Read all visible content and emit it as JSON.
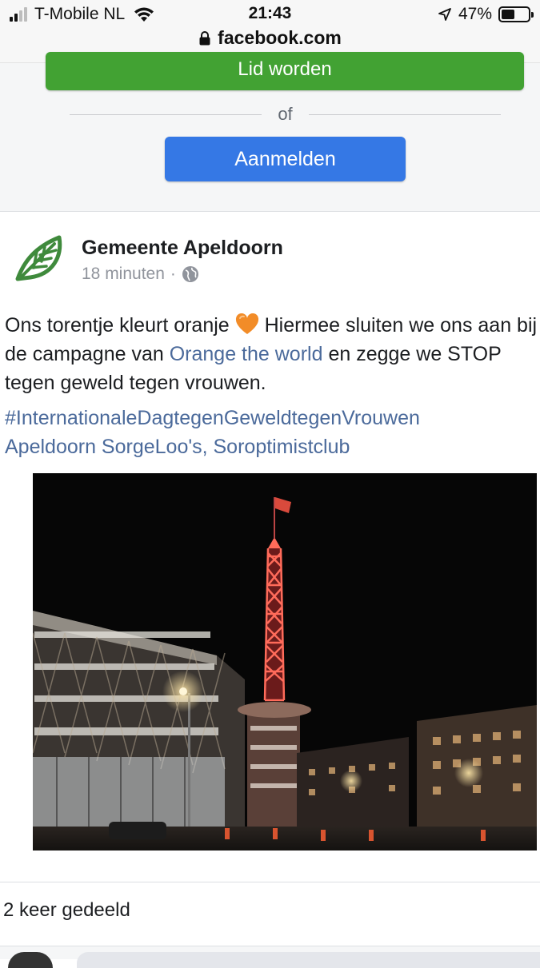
{
  "status_bar": {
    "carrier": "T-Mobile NL",
    "time": "21:43",
    "battery": "47%",
    "battery_level": 0.47,
    "signal_bars": 2
  },
  "address_bar": {
    "url": "facebook.com"
  },
  "login": {
    "join_label": "Lid worden",
    "or_label": "of",
    "login_label": "Aanmelden"
  },
  "post": {
    "page_name": "Gemeente Apeldoorn",
    "time_ago": "18 minuten",
    "separator": "·",
    "text_part1": "Ons torentje kleurt oranje",
    "text_part2": "Hiermee sluiten we ons aan bij de campagne van",
    "link_text": "Orange the world",
    "text_part3": "en zegge we STOP tegen geweld tegen vrouwen.",
    "hashtag": "#InternationaleDagtegenGeweldtegenVrouwen",
    "tags_line": "Apeldoorn SorgeLoo's, Soroptimistclub",
    "shares": "2 keer gedeeld"
  },
  "colors": {
    "join_button": "#42a233",
    "login_button": "#3578e5",
    "link": "#4b6a9b",
    "heart": "#f28c28",
    "logo_green": "#3f8a3c"
  },
  "icons": {
    "wifi": "wifi-icon",
    "location": "location-arrow-icon",
    "lock": "lock-icon",
    "globe": "globe-icon",
    "heart": "orange-heart-emoji",
    "logo": "leaf-logo"
  }
}
